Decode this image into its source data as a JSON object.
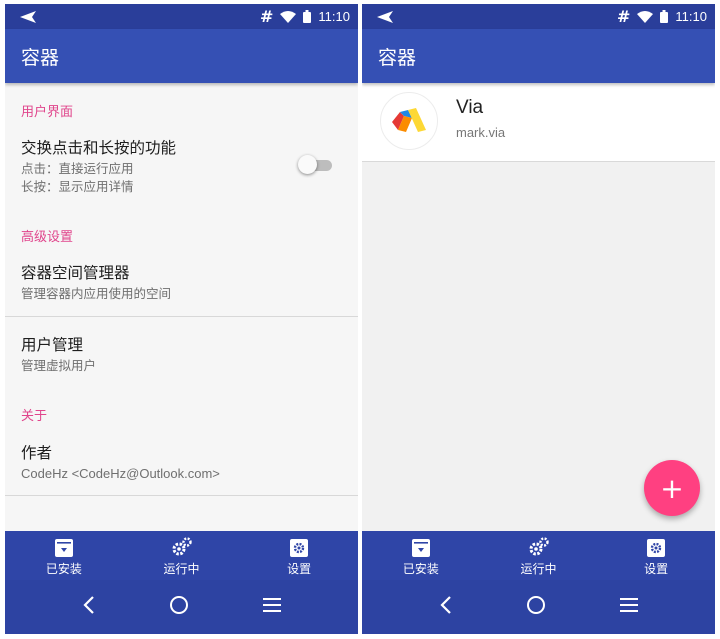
{
  "status_bar": {
    "time": "11:10"
  },
  "left_screen": {
    "title": "容器",
    "sections": [
      {
        "header": "用户界面",
        "items": [
          {
            "title": "交换点击和长按的功能",
            "subtitle_lines": [
              "点击：直接运行应用",
              "长按：显示应用详情"
            ],
            "toggle_on": false
          }
        ]
      },
      {
        "header": "高级设置",
        "items": [
          {
            "title": "容器空间管理器",
            "subtitle": "管理容器内应用使用的空间"
          },
          {
            "title": "用户管理",
            "subtitle": "管理虚拟用户"
          }
        ]
      },
      {
        "header": "关于",
        "items": [
          {
            "title": "作者",
            "subtitle": "CodeHz <CodeHz@Outlook.com>"
          }
        ]
      }
    ]
  },
  "right_screen": {
    "title": "容器",
    "apps": [
      {
        "name": "Via",
        "package": "mark.via"
      }
    ],
    "fab_label": "+"
  },
  "bottom_nav": {
    "items": [
      {
        "label": "已安装",
        "icon": "archive-icon"
      },
      {
        "label": "运行中",
        "icon": "gears-icon"
      },
      {
        "label": "设置",
        "icon": "settings-icon"
      }
    ]
  },
  "colors": {
    "status_bar": "#2a3e9a",
    "app_bar": "#3550b4",
    "bottom_nav": "#2f45a7",
    "accent": "#e0458c",
    "fab": "#ff4081"
  }
}
